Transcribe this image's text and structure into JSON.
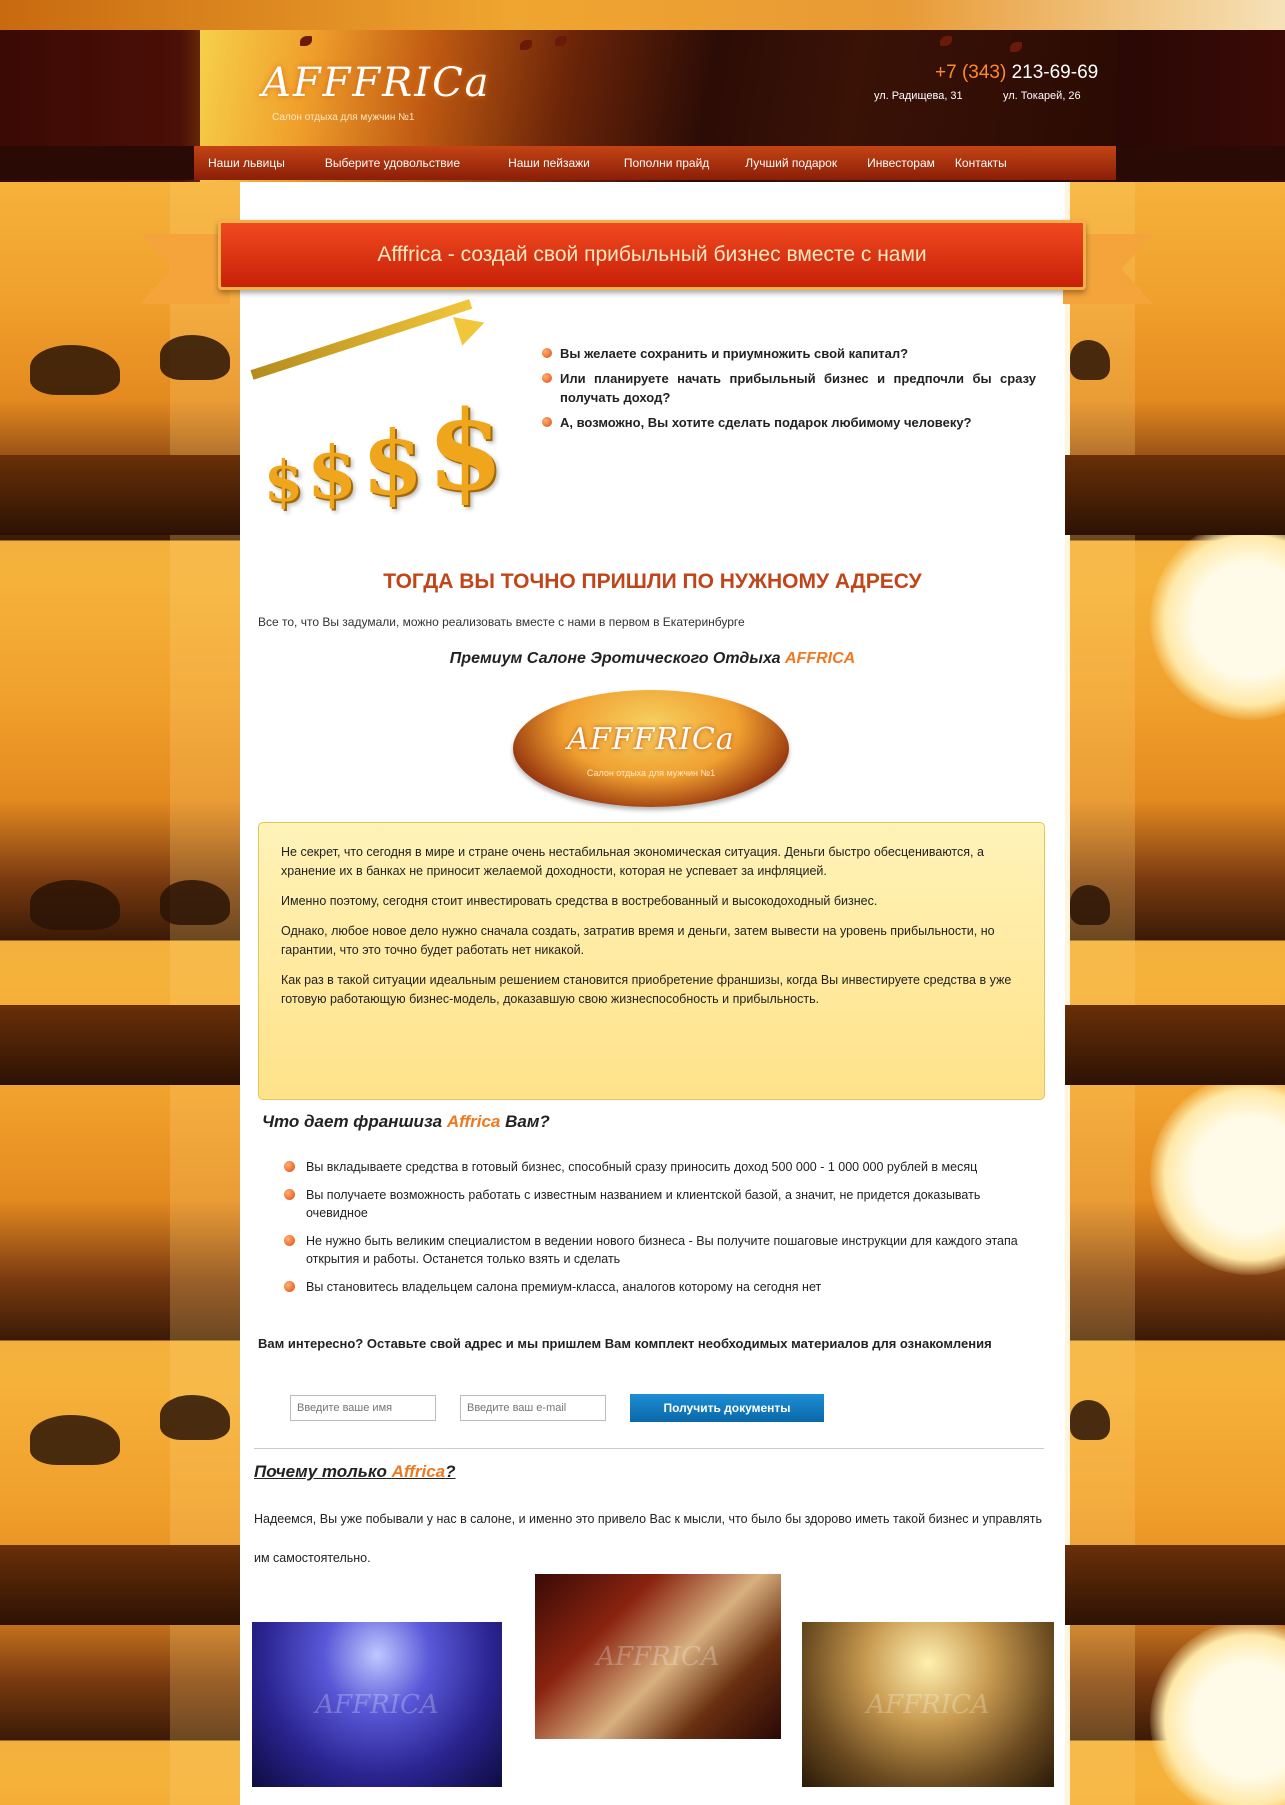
{
  "header": {
    "logo_text": "AFFFRICa",
    "tagline": "Салон отдыха для мужчин №1",
    "phone_code": "+7 (343)",
    "phone_number": "213-69-69",
    "address_1": "ул. Радищева, 31",
    "address_2": "ул. Токарей, 26"
  },
  "nav": {
    "items": [
      "Наши львицы",
      "Выберите удовольствие",
      "Наши пейзажи",
      "Пополни прайд",
      "Лучший подарок",
      "Инвесторам",
      "Контакты"
    ]
  },
  "banner": {
    "title": "Afffrica - создай свой прибыльный бизнес вместе с нами"
  },
  "questions": [
    "Вы желаете сохранить и приумножить свой капитал?",
    "Или планируете начать прибыльный бизнес и предпочли бы сразу получать доход?",
    "А, возможно, Вы хотите сделать подарок любимому человеку?"
  ],
  "main": {
    "headline": "ТОГДА ВЫ ТОЧНО ПРИШЛИ ПО НУЖНОМУ АДРЕСУ",
    "intro": "Все то, что Вы задумали, можно реализовать вместе с нами в первом в Екатеринбурге",
    "premium_prefix": "Премиум Салоне Эротического Отдыха",
    "premium_brand": "AFFRICA",
    "logo_text": "AFFFRICa",
    "logo_tagline": "Салон отдыха для мужчин №1"
  },
  "info_box": {
    "paragraphs": [
      "Не секрет, что сегодня в мире и стране очень нестабильная экономическая ситуация. Деньги быстро обесцениваются, а хранение их в банках не приносит желаемой доходности, которая не успевает за инфляцией.",
      "Именно поэтому, сегодня стоит инвестировать средства в востребованный и высокодоходный бизнес.",
      "Однако, любое новое дело нужно сначала создать, затратив время и деньги, затем вывести на уровень прибыльности, но гарантии, что это точно будет работать нет никакой.",
      "Как раз в такой ситуации идеальным решением становится приобретение франшизы, когда Вы инвестируете средства в уже готовую работающую бизнес-модель, доказавшую свою жизнеспособность и прибыльность."
    ]
  },
  "franchise": {
    "heading_prefix": "Что дает франшиза",
    "heading_brand": "Affrica",
    "heading_suffix": "Вам?",
    "benefits": [
      "Вы вкладываете средства в готовый бизнес, способный сразу приносить доход 500 000 - 1 000 000 рублей в месяц",
      "Вы получаете возможность работать с известным названием и клиентской базой, а значит, не придется доказывать очевидное",
      "Не нужно быть великим специалистом в ведении нового бизнеса - Вы получите пошаговые инструкции для каждого этапа открытия и работы. Останется только взять и сделать",
      "Вы становитесь владельцем салона премиум-класса, аналогов которому на сегодня нет"
    ]
  },
  "cta": {
    "text": "Вам интересно? Оставьте свой адрес и мы пришлем Вам комплект необходимых материалов для ознакомления",
    "name_placeholder": "Введите ваше имя",
    "email_placeholder": "Введите ваш e-mail",
    "button_label": "Получить документы"
  },
  "why": {
    "heading_prefix": "Почему только",
    "heading_brand": "Affrica",
    "heading_suffix": "?",
    "text": "Надеемся, Вы уже побывали у нас в салоне, и именно это привело Вас к мысли, что было бы здорово иметь такой бизнес и управлять им самостоятельно.",
    "watermark": "AFFRICA"
  },
  "colors": {
    "accent": "#f07820",
    "headline": "#c0461a",
    "ribbon": "#e03a14",
    "button": "#1279be"
  }
}
